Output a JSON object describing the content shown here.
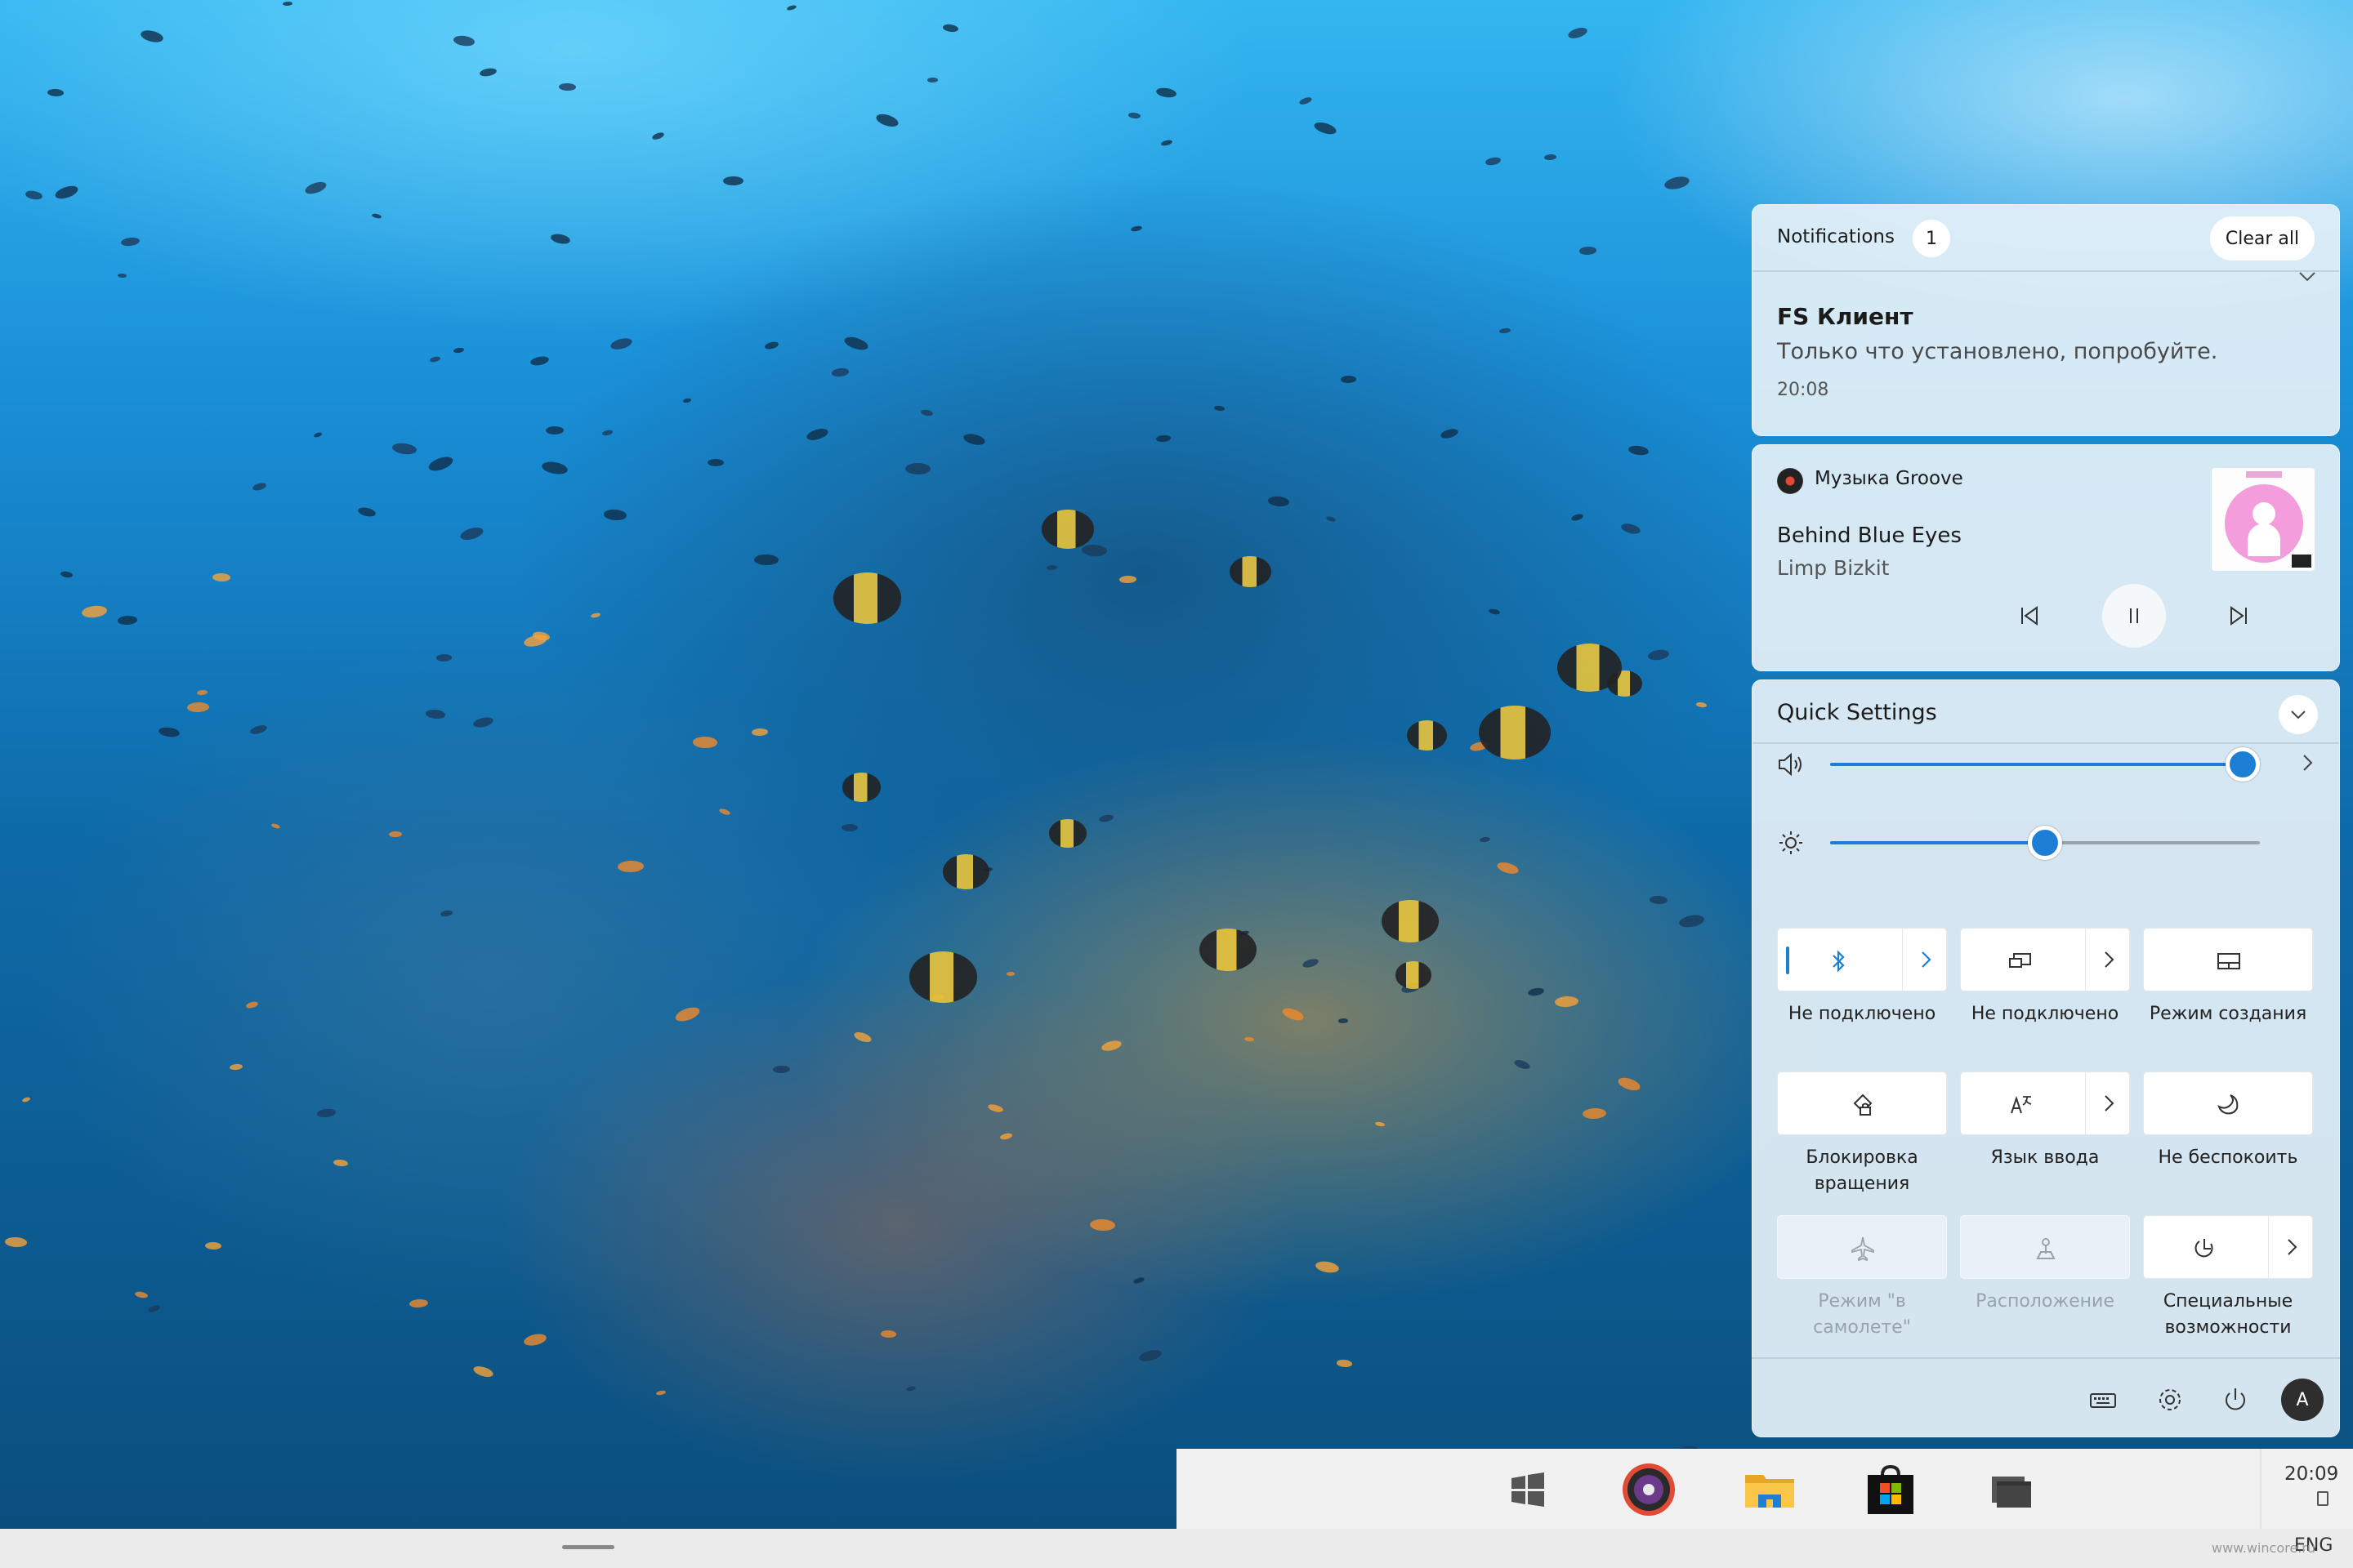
{
  "notifications": {
    "title": "Notifications",
    "count": "1",
    "clear_all_label": "Clear all",
    "toast": {
      "app": "FS Клиент",
      "message": "Только что установлено, попробуйте.",
      "time": "20:08"
    }
  },
  "media": {
    "app": "Музыка Groove",
    "track_title": "Behind Blue Eyes",
    "artist": "Limp Bizkit"
  },
  "quick_settings": {
    "title": "Quick Settings",
    "volume_level": 0.96,
    "brightness_level": 0.5,
    "tiles": [
      {
        "label": "Не подключено",
        "icon": "bluetooth-icon",
        "active": true
      },
      {
        "label": "Не подключено",
        "icon": "project-icon",
        "active": false
      },
      {
        "label": "Режим создания",
        "icon": "tablet-mode-icon",
        "active": false
      },
      {
        "label": "Блокировка вращения",
        "icon": "rotation-lock-icon",
        "active": false
      },
      {
        "label": "Язык ввода",
        "icon": "input-language-icon",
        "active": false
      },
      {
        "label": "Не беспокоить",
        "icon": "moon-icon",
        "active": false
      },
      {
        "label": "Режим \"в самолете\"",
        "icon": "airplane-icon",
        "active": false,
        "disabled": true
      },
      {
        "label": "Расположение",
        "icon": "location-icon",
        "active": false,
        "disabled": true
      },
      {
        "label": "Специальные возможности",
        "icon": "accessibility-icon",
        "active": false
      }
    ],
    "user_initial": "A"
  },
  "taskbar": {
    "clock": "20:09",
    "language": "ENG"
  },
  "watermark": "www.wincore.ru",
  "colors": {
    "accent": "#1d7ed6",
    "panel": "#e4f0f8"
  }
}
